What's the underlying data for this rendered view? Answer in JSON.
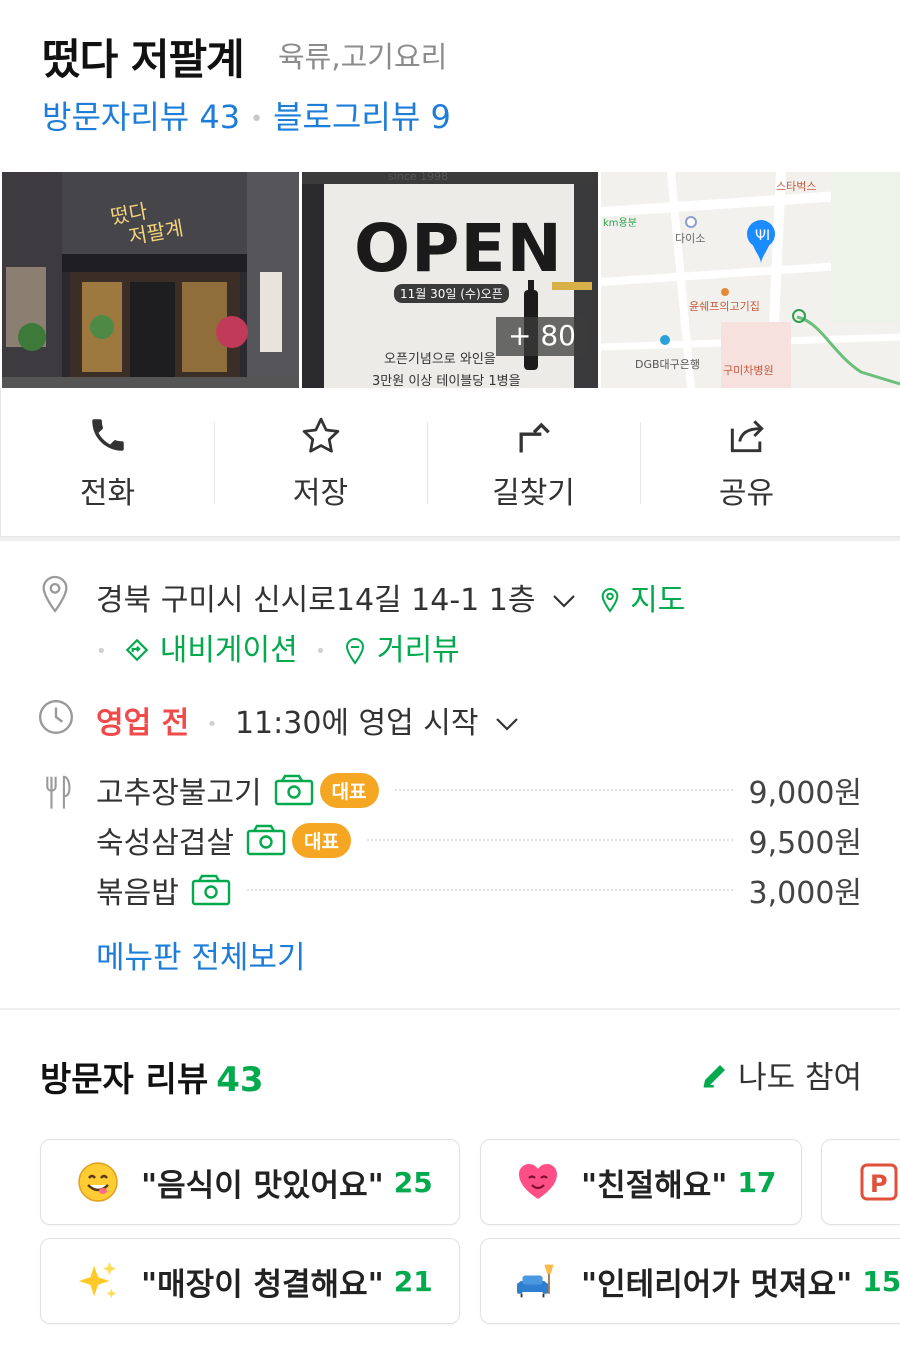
{
  "place": {
    "name": "떴다 저팔계",
    "category": "육류,고기요리",
    "visitor_reviews_label": "방문자리뷰 43",
    "blog_reviews_label": "블로그리뷰 9"
  },
  "photos": {
    "open_sign": "OPEN",
    "open_date": "11월 30일 (수)오픈",
    "since": "since 1998",
    "promo_line1": "오픈기념으로 와인을",
    "promo_line2": "3만원 이상 테이블당 1병을",
    "more_count": "+ 80",
    "map_labels": [
      "스타벅스",
      "다이소",
      "km용분",
      "윤쉐프의고기집",
      "DGB대구은행",
      "구미차병원"
    ]
  },
  "actions": [
    {
      "label": "전화",
      "icon": "phone-icon"
    },
    {
      "label": "저장",
      "icon": "star-icon"
    },
    {
      "label": "길찾기",
      "icon": "directions-icon"
    },
    {
      "label": "공유",
      "icon": "share-icon"
    }
  ],
  "info": {
    "address": "경북 구미시 신시로14길 14-1 1층",
    "map_link": "지도",
    "navigation_link": "내비게이션",
    "streetview_link": "거리뷰",
    "status": "영업 전",
    "hours_text": "11:30에 영업 시작"
  },
  "menu": {
    "items": [
      {
        "name": "고추장불고기",
        "badge": "대표",
        "price": "9,000원"
      },
      {
        "name": "숙성삼겹살",
        "badge": "대표",
        "price": "9,500원"
      },
      {
        "name": "볶음밥",
        "badge": "",
        "price": "3,000원"
      }
    ],
    "view_all": "메뉴판 전체보기"
  },
  "visitor_reviews": {
    "title": "방문자 리뷰",
    "count": "43",
    "write_label": "나도 참여",
    "keywords": [
      {
        "text": "\"음식이 맛있어요\"",
        "count": "25",
        "icon": "yum-face-icon"
      },
      {
        "text": "\"친절해요\"",
        "count": "17",
        "icon": "heart-face-icon"
      },
      {
        "text": "\"매장이 청결해요\"",
        "count": "21",
        "icon": "sparkles-icon"
      },
      {
        "text": "\"인테리어가 멋져요\"",
        "count": "15",
        "icon": "sofa-lamp-icon"
      }
    ]
  },
  "colors": {
    "link_blue": "#1d7dd8",
    "green": "#03a94d",
    "status_red": "#f04a4a",
    "badge_orange": "#f5a623"
  }
}
